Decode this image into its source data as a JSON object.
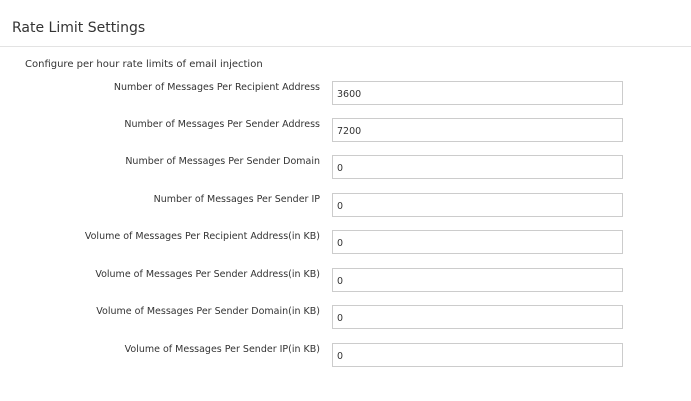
{
  "header": {
    "title": "Rate Limit Settings"
  },
  "form": {
    "description": "Configure per hour rate limits of email injection",
    "fields": [
      {
        "label": "Number of Messages Per Recipient Address",
        "value": "3600"
      },
      {
        "label": "Number of Messages Per Sender Address",
        "value": "7200"
      },
      {
        "label": "Number of Messages Per Sender Domain",
        "value": "0"
      },
      {
        "label": "Number of Messages Per Sender IP",
        "value": "0"
      },
      {
        "label": "Volume of Messages Per Recipient Address(in KB)",
        "value": "0"
      },
      {
        "label": "Volume of Messages Per Sender Address(in KB)",
        "value": "0"
      },
      {
        "label": "Volume of Messages Per Sender Domain(in KB)",
        "value": "0"
      },
      {
        "label": "Volume of Messages Per Sender IP(in KB)",
        "value": "0"
      }
    ]
  }
}
